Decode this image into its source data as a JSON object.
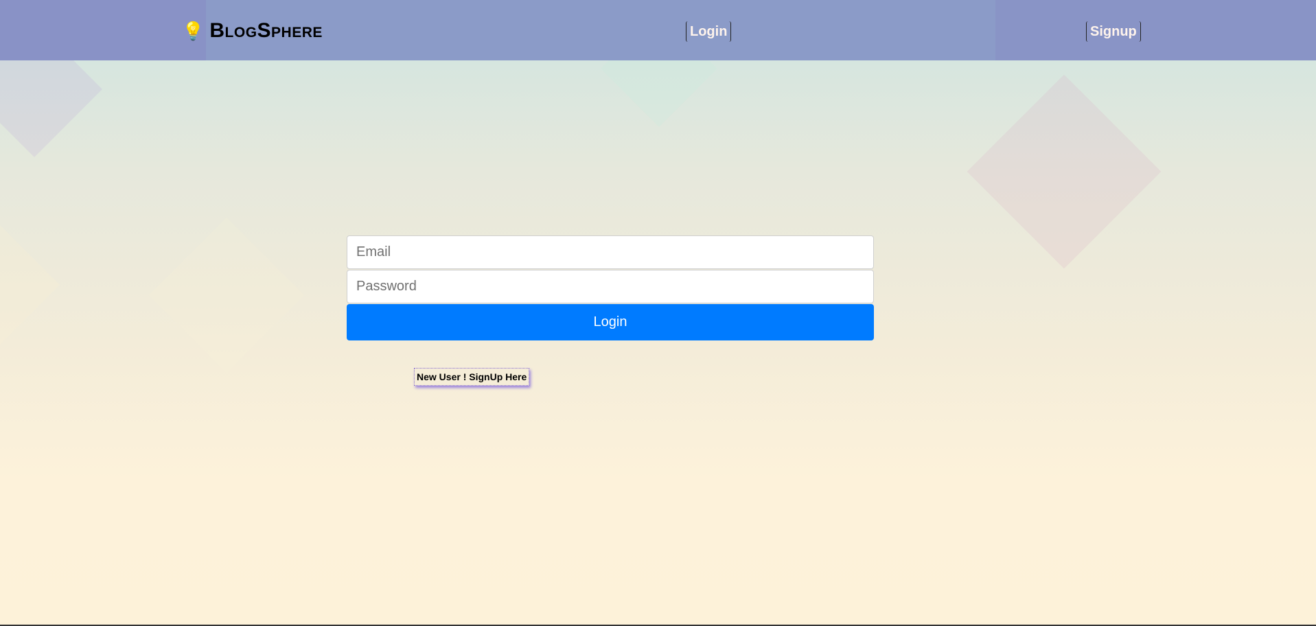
{
  "navbar": {
    "brand_icon": "lightbulb-icon",
    "brand": "BlogSphere",
    "login_label": "Login",
    "signup_label": "Signup",
    "background_color": "#8b9bc8"
  },
  "form": {
    "email_placeholder": "Email",
    "password_placeholder": "Password",
    "submit_label": "Login",
    "submit_color": "#007bff"
  },
  "signup_link": "New User ! SignUp Here"
}
